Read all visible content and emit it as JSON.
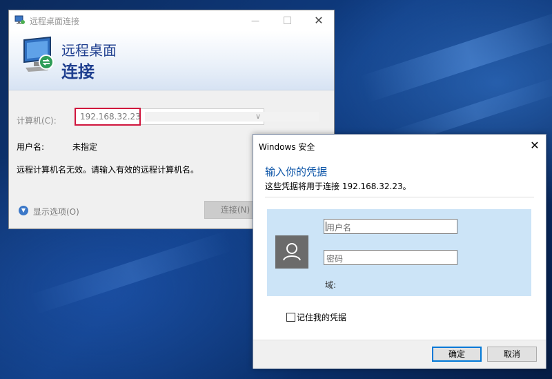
{
  "rdp": {
    "window_title": "远程桌面连接",
    "banner_line1": "远程桌面",
    "banner_line2": "连接",
    "computer_label": "计算机(C):",
    "computer_value": "192.168.32.23",
    "user_label": "用户名:",
    "user_value": "未指定",
    "error_message": "远程计算机名无效。请输入有效的远程计算机名。",
    "show_options": "显示选项(O)",
    "connect_button": "连接(N)"
  },
  "security": {
    "window_title": "Windows 安全",
    "heading": "输入你的凭据",
    "subtitle": "这些凭据将用于连接 192.168.32.23。",
    "username_placeholder": "用户名",
    "password_placeholder": "密码",
    "domain_label": "域:",
    "remember_label": "记住我的凭据",
    "remember_checked": false,
    "ok_button": "确定",
    "cancel_button": "取消"
  },
  "colors": {
    "accent_blue": "#0e56a8",
    "highlight_red": "#d0143c",
    "credential_panel": "#cce4f7"
  }
}
